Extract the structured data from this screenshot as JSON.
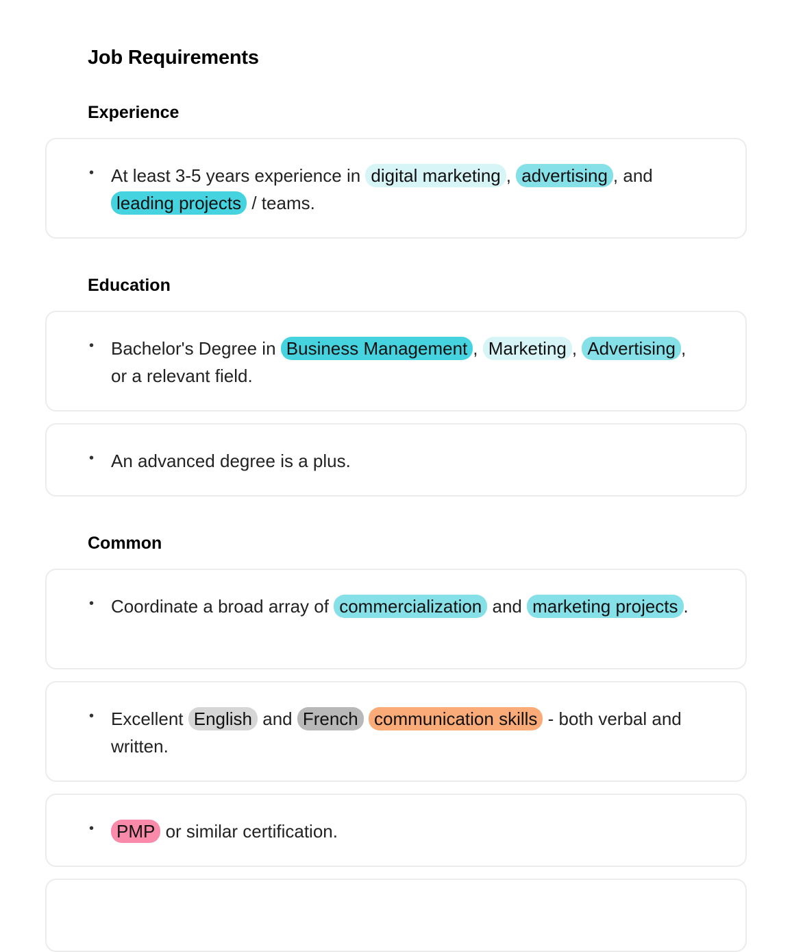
{
  "page": {
    "title": "Job Requirements"
  },
  "tag_colors": {
    "skill_light": "#d7f4f7",
    "skill_medium": "#86e0e8",
    "skill_strong": "#45d3df",
    "language_light": "#d6d6d6",
    "language_dark": "#b8b8b8",
    "soft_skill": "#fbab78",
    "certification": "#f98aaa"
  },
  "sections": [
    {
      "title": "Experience",
      "items": [
        {
          "segments": [
            {
              "text": "At least 3-5 years experience in "
            },
            {
              "text": "digital marketing",
              "tag": "skill_light"
            },
            {
              "text": ", "
            },
            {
              "text": "advertising",
              "tag": "skill_medium"
            },
            {
              "text": ", and "
            },
            {
              "text": "leading projects",
              "tag": "skill_strong"
            },
            {
              "text": " / teams."
            }
          ]
        }
      ]
    },
    {
      "title": "Education",
      "items": [
        {
          "segments": [
            {
              "text": "Bachelor's Degree in "
            },
            {
              "text": "Business Management",
              "tag": "skill_strong"
            },
            {
              "text": ", "
            },
            {
              "text": "Marketing",
              "tag": "skill_light"
            },
            {
              "text": ", "
            },
            {
              "text": "Advertising",
              "tag": "skill_medium"
            },
            {
              "text": ", or a relevant field."
            }
          ]
        },
        {
          "segments": [
            {
              "text": "An advanced degree is a plus."
            }
          ]
        }
      ]
    },
    {
      "title": "Common",
      "items": [
        {
          "segments": [
            {
              "text": "Coordinate a broad array of "
            },
            {
              "text": "commercialization",
              "tag": "skill_medium"
            },
            {
              "text": " and "
            },
            {
              "text": "marketing projects",
              "tag": "skill_medium"
            },
            {
              "text": "."
            }
          ]
        },
        {
          "segments": [
            {
              "text": "Excellent "
            },
            {
              "text": "English",
              "tag": "language_light"
            },
            {
              "text": " and "
            },
            {
              "text": "French",
              "tag": "language_dark"
            },
            {
              "text": " "
            },
            {
              "text": "communication skills",
              "tag": "soft_skill"
            },
            {
              "text": " - both verbal and written."
            }
          ]
        },
        {
          "segments": [
            {
              "text": "PMP",
              "tag": "certification"
            },
            {
              "text": " or similar certification."
            }
          ]
        },
        {
          "segments": []
        }
      ]
    }
  ],
  "bullet_glyph": "•"
}
